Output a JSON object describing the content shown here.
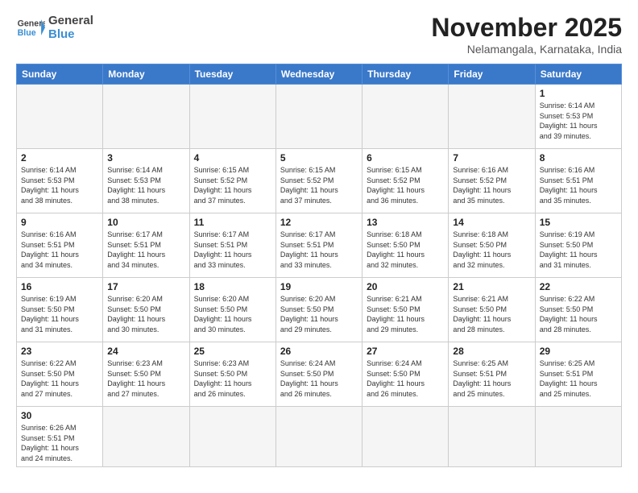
{
  "header": {
    "logo_general": "General",
    "logo_blue": "Blue",
    "month": "November 2025",
    "location": "Nelamangala, Karnataka, India"
  },
  "weekdays": [
    "Sunday",
    "Monday",
    "Tuesday",
    "Wednesday",
    "Thursday",
    "Friday",
    "Saturday"
  ],
  "days": {
    "1": {
      "sunrise": "6:14 AM",
      "sunset": "5:53 PM",
      "daylight": "11 hours and 39 minutes."
    },
    "2": {
      "sunrise": "6:14 AM",
      "sunset": "5:53 PM",
      "daylight": "11 hours and 38 minutes."
    },
    "3": {
      "sunrise": "6:14 AM",
      "sunset": "5:53 PM",
      "daylight": "11 hours and 38 minutes."
    },
    "4": {
      "sunrise": "6:15 AM",
      "sunset": "5:52 PM",
      "daylight": "11 hours and 37 minutes."
    },
    "5": {
      "sunrise": "6:15 AM",
      "sunset": "5:52 PM",
      "daylight": "11 hours and 37 minutes."
    },
    "6": {
      "sunrise": "6:15 AM",
      "sunset": "5:52 PM",
      "daylight": "11 hours and 36 minutes."
    },
    "7": {
      "sunrise": "6:16 AM",
      "sunset": "5:52 PM",
      "daylight": "11 hours and 35 minutes."
    },
    "8": {
      "sunrise": "6:16 AM",
      "sunset": "5:51 PM",
      "daylight": "11 hours and 35 minutes."
    },
    "9": {
      "sunrise": "6:16 AM",
      "sunset": "5:51 PM",
      "daylight": "11 hours and 34 minutes."
    },
    "10": {
      "sunrise": "6:17 AM",
      "sunset": "5:51 PM",
      "daylight": "11 hours and 34 minutes."
    },
    "11": {
      "sunrise": "6:17 AM",
      "sunset": "5:51 PM",
      "daylight": "11 hours and 33 minutes."
    },
    "12": {
      "sunrise": "6:17 AM",
      "sunset": "5:51 PM",
      "daylight": "11 hours and 33 minutes."
    },
    "13": {
      "sunrise": "6:18 AM",
      "sunset": "5:50 PM",
      "daylight": "11 hours and 32 minutes."
    },
    "14": {
      "sunrise": "6:18 AM",
      "sunset": "5:50 PM",
      "daylight": "11 hours and 32 minutes."
    },
    "15": {
      "sunrise": "6:19 AM",
      "sunset": "5:50 PM",
      "daylight": "11 hours and 31 minutes."
    },
    "16": {
      "sunrise": "6:19 AM",
      "sunset": "5:50 PM",
      "daylight": "11 hours and 31 minutes."
    },
    "17": {
      "sunrise": "6:20 AM",
      "sunset": "5:50 PM",
      "daylight": "11 hours and 30 minutes."
    },
    "18": {
      "sunrise": "6:20 AM",
      "sunset": "5:50 PM",
      "daylight": "11 hours and 30 minutes."
    },
    "19": {
      "sunrise": "6:20 AM",
      "sunset": "5:50 PM",
      "daylight": "11 hours and 29 minutes."
    },
    "20": {
      "sunrise": "6:21 AM",
      "sunset": "5:50 PM",
      "daylight": "11 hours and 29 minutes."
    },
    "21": {
      "sunrise": "6:21 AM",
      "sunset": "5:50 PM",
      "daylight": "11 hours and 28 minutes."
    },
    "22": {
      "sunrise": "6:22 AM",
      "sunset": "5:50 PM",
      "daylight": "11 hours and 28 minutes."
    },
    "23": {
      "sunrise": "6:22 AM",
      "sunset": "5:50 PM",
      "daylight": "11 hours and 27 minutes."
    },
    "24": {
      "sunrise": "6:23 AM",
      "sunset": "5:50 PM",
      "daylight": "11 hours and 27 minutes."
    },
    "25": {
      "sunrise": "6:23 AM",
      "sunset": "5:50 PM",
      "daylight": "11 hours and 26 minutes."
    },
    "26": {
      "sunrise": "6:24 AM",
      "sunset": "5:50 PM",
      "daylight": "11 hours and 26 minutes."
    },
    "27": {
      "sunrise": "6:24 AM",
      "sunset": "5:50 PM",
      "daylight": "11 hours and 26 minutes."
    },
    "28": {
      "sunrise": "6:25 AM",
      "sunset": "5:51 PM",
      "daylight": "11 hours and 25 minutes."
    },
    "29": {
      "sunrise": "6:25 AM",
      "sunset": "5:51 PM",
      "daylight": "11 hours and 25 minutes."
    },
    "30": {
      "sunrise": "6:26 AM",
      "sunset": "5:51 PM",
      "daylight": "11 hours and 24 minutes."
    }
  },
  "labels": {
    "sunrise": "Sunrise:",
    "sunset": "Sunset:",
    "daylight": "Daylight:"
  }
}
